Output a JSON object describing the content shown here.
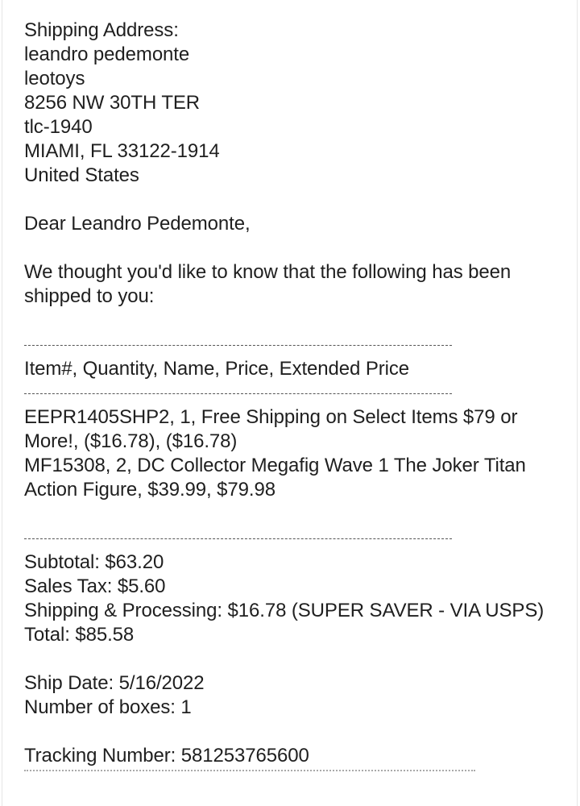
{
  "address": {
    "heading": "Shipping Address:",
    "name": "leandro pedemonte",
    "company": "leotoys",
    "street": "8256 NW 30TH TER",
    "unit": "tlc-1940",
    "city_state_zip": "MIAMI, FL 33122-1914",
    "country": "United States"
  },
  "greeting": "Dear Leandro Pedemonte,",
  "intro": "We thought you'd like to know that the following has been shipped to you:",
  "table": {
    "header": "Item#,  Quantity,  Name,  Price,  Extended Price",
    "items": [
      "EEPR1405SHP2,  1,  Free Shipping on Select Items $79 or More!,  ($16.78),  ($16.78)",
      "MF15308,  2,  DC Collector Megafig Wave 1 The Joker Titan Action Figure,  $39.99,  $79.98"
    ]
  },
  "totals": {
    "subtotal": "Subtotal: $63.20",
    "sales_tax": "Sales Tax:  $5.60",
    "shipping": "Shipping & Processing: $16.78 (SUPER SAVER - VIA USPS)",
    "total": "Total: $85.58"
  },
  "shipment": {
    "ship_date": "Ship Date: 5/16/2022",
    "boxes": "Number of boxes: 1",
    "tracking": "Tracking Number: 581253765600"
  }
}
